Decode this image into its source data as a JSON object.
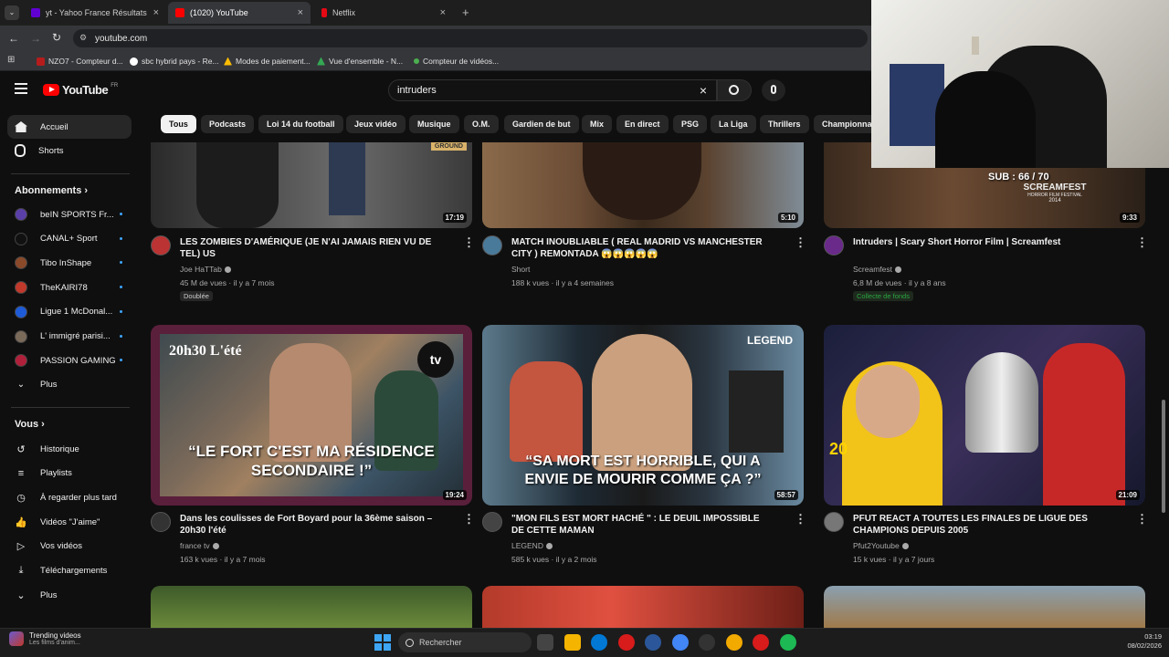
{
  "browser": {
    "tabs": [
      {
        "title": "yt - Yahoo France Résultats de l"
      },
      {
        "title": "(1020) YouTube"
      },
      {
        "title": "Netflix"
      }
    ],
    "url": "youtube.com",
    "bookmarks": [
      "NZO7 - Compteur d...",
      "sbc hybrid pays - Re...",
      "Modes de paiement...",
      "Vue d'ensemble - N...",
      "Compteur de vidéos..."
    ]
  },
  "youtube": {
    "logo": "YouTube",
    "region": "FR",
    "search_value": "intruders",
    "chips": [
      "Tous",
      "Podcasts",
      "Loi 14 du football",
      "Jeux vidéo",
      "Musique",
      "O.M.",
      "Gardien de but",
      "Mix",
      "En direct",
      "PSG",
      "La Liga",
      "Thrillers",
      "Championna"
    ],
    "sidebar": {
      "main": [
        "Accueil",
        "Shorts"
      ],
      "subs_heading": "Abonnements",
      "subs": [
        "beIN SPORTS Fr...",
        "CANAL+ Sport",
        "Tibo InShape",
        "TheKAIRI78",
        "Ligue 1 McDonal...",
        "L' immigré parisi...",
        "PASSION GAMING",
        "Plus"
      ],
      "you_heading": "Vous",
      "you": [
        "Historique",
        "Playlists",
        "À regarder plus tard",
        "Vidéos \"J'aime\"",
        "Vos vidéos",
        "Téléchargements",
        "Plus"
      ]
    },
    "videos": [
      {
        "title": "LES ZOMBIES D'AMÉRIQUE (JE N'AI JAMAIS RIEN VU DE TEL) US",
        "channel": "Joe HaTTab",
        "views": "45 M de vues",
        "age": "il y a 7 mois",
        "duration": "17:19",
        "badge": "Doublée",
        "thumb_text": "GROUND"
      },
      {
        "title": "MATCH INOUBLIABLE ( REAL MADRID VS MANCHESTER CITY ) REMONTADA 😱😱😱😱😱",
        "channel": "Short",
        "views": "188 k vues",
        "age": "il y a 4 semaines",
        "duration": "5:10"
      },
      {
        "title": "Intruders | Scary Short Horror Film | Screamfest",
        "channel": "Screamfest",
        "views": "6,8 M de vues",
        "age": "il y a 8 ans",
        "duration": "9:33",
        "badge": "Collecte de fonds",
        "thumb_text": "SCREAMFEST",
        "thumb_sub": "HORROR FILM FESTIVAL",
        "thumb_year": "2014"
      },
      {
        "title": "Dans les coulisses de Fort Boyard pour la 36ème saison – 20h30 l'été",
        "channel": "france tv",
        "views": "163 k vues",
        "age": "il y a 7 mois",
        "duration": "19:24",
        "thumb_text": "“LE FORT C'EST MA RÉSIDENCE SECONDAIRE !”",
        "thumb_tag": "20h30 L'été",
        "thumb_logo": "tv"
      },
      {
        "title": "\"MON FILS EST MORT HACHÉ \" : LE DEUIL IMPOSSIBLE DE CETTE MAMAN",
        "channel": "LEGEND",
        "views": "585 k vues",
        "age": "il y a 2 mois",
        "duration": "58:57",
        "thumb_text": "“SA MORT EST HORRIBLE, QUI A ENVIE DE MOURIR COMME ÇA ?”",
        "thumb_tag": "LEGEND"
      },
      {
        "title": "PFUT REACT A TOUTES LES FINALES DE LIGUE DES CHAMPIONS DEPUIS 2005",
        "channel": "Pfut2Youtube",
        "views": "15 k vues",
        "age": "il y a 7 jours",
        "duration": "21:09",
        "thumb_text": "20"
      }
    ]
  },
  "webcam": {
    "overlay": "SUB : 66 / 70"
  },
  "taskbar": {
    "widget_title": "Trending videos",
    "widget_sub": "Les films d'anim...",
    "search_placeholder": "Rechercher",
    "time": "03:19",
    "date": "08/02/2026"
  },
  "colors": {
    "accent": "#ff0000",
    "link": "#3ea6ff",
    "verified": "#aaaaaa",
    "fund": "#2ba640"
  }
}
